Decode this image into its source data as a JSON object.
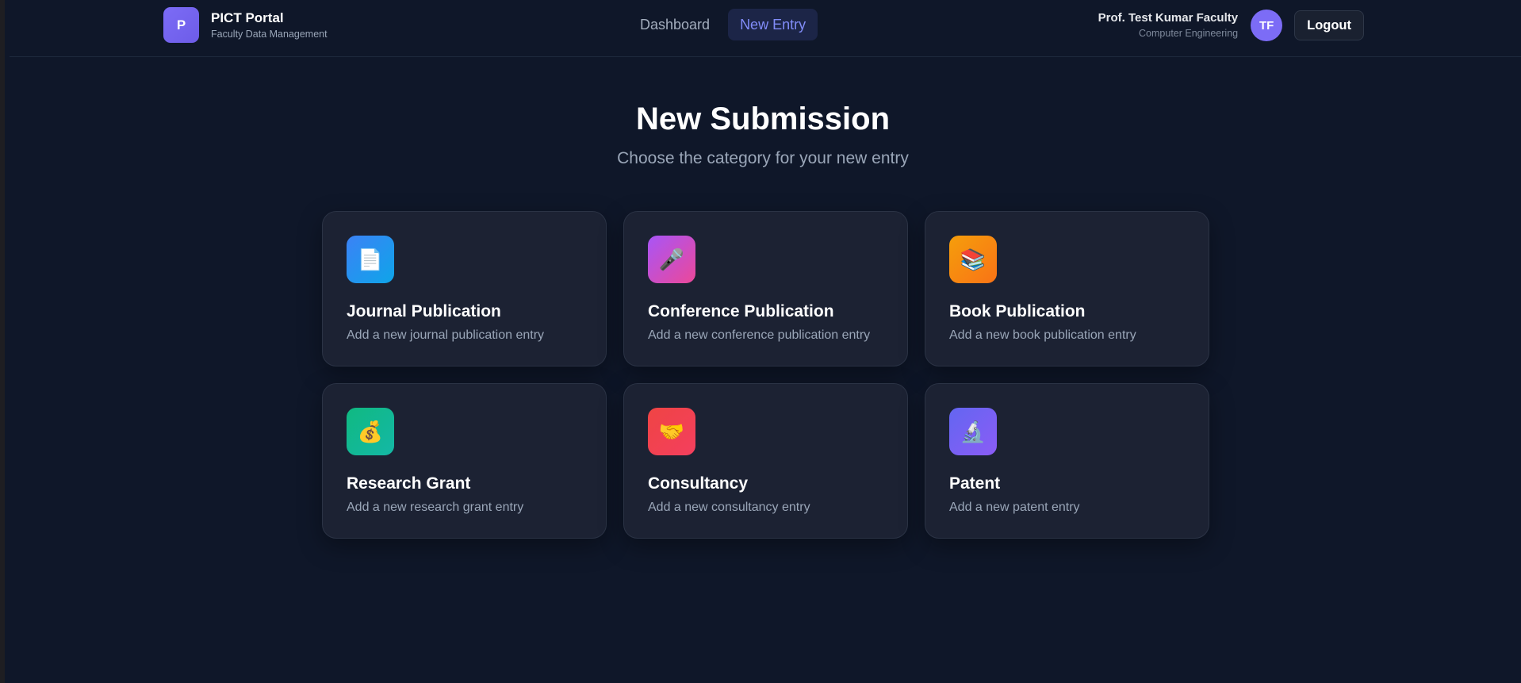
{
  "brand": {
    "logo_letter": "P",
    "title": "PICT Portal",
    "subtitle": "Faculty Data Management"
  },
  "nav": {
    "items": [
      {
        "label": "Dashboard",
        "active": false
      },
      {
        "label": "New Entry",
        "active": true
      }
    ]
  },
  "user": {
    "name": "Prof. Test Kumar Faculty",
    "department": "Computer Engineering",
    "initials": "TF",
    "logout_label": "Logout"
  },
  "main": {
    "title": "New Submission",
    "subtitle": "Choose the category for your new entry"
  },
  "categories": [
    {
      "title": "Journal Publication",
      "description": "Add a new journal publication entry",
      "icon": "document-icon",
      "glyph": "📄",
      "color_from": "#3b82f6",
      "color_to": "#0ea5e9"
    },
    {
      "title": "Conference Publication",
      "description": "Add a new conference publication entry",
      "icon": "microphone-icon",
      "glyph": "🎤",
      "color_from": "#a855f7",
      "color_to": "#ec4899"
    },
    {
      "title": "Book Publication",
      "description": "Add a new book publication entry",
      "icon": "books-icon",
      "glyph": "📚",
      "color_from": "#f59e0b",
      "color_to": "#f97316"
    },
    {
      "title": "Research Grant",
      "description": "Add a new research grant entry",
      "icon": "money-bag-icon",
      "glyph": "💰",
      "color_from": "#10b981",
      "color_to": "#14b8a6"
    },
    {
      "title": "Consultancy",
      "description": "Add a new consultancy entry",
      "icon": "handshake-icon",
      "glyph": "🤝",
      "color_from": "#ef4444",
      "color_to": "#f43f5e"
    },
    {
      "title": "Patent",
      "description": "Add a new patent entry",
      "icon": "microscope-icon",
      "glyph": "🔬",
      "color_from": "#6366f1",
      "color_to": "#8b5cf6"
    }
  ]
}
